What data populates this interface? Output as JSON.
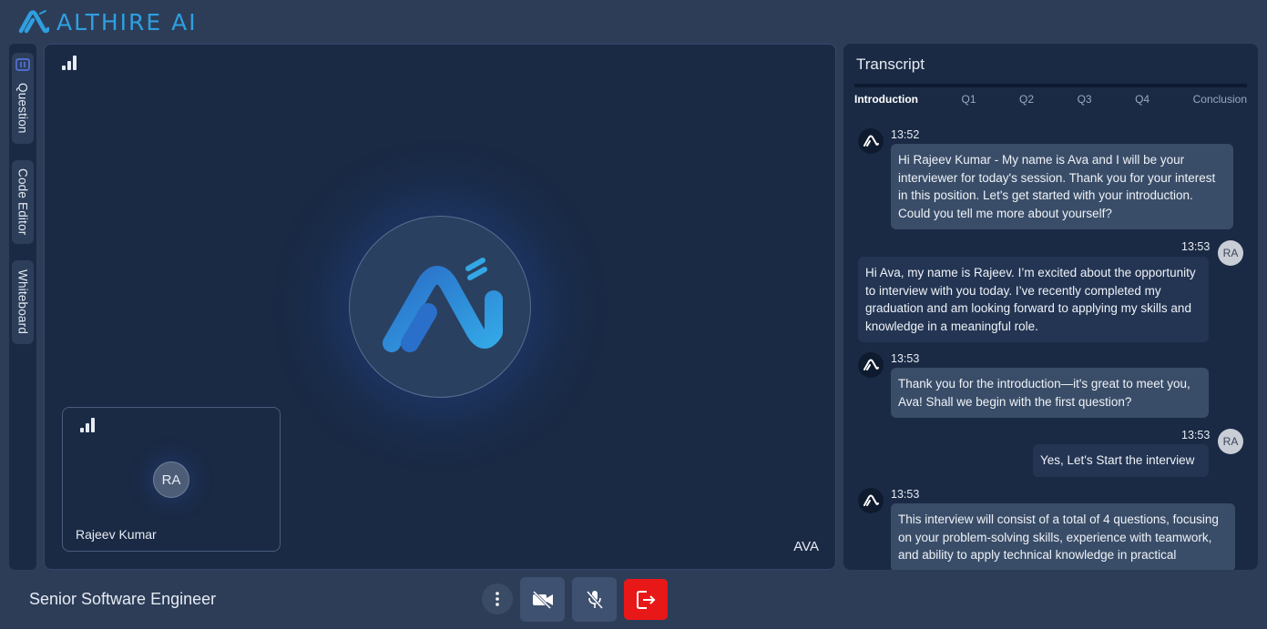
{
  "brand": {
    "name": "ALTHIRE AI",
    "color": "#2e9fe0",
    "logo_icon": "althire-logo-icon"
  },
  "sidebar": {
    "tabs": [
      {
        "label": "Question",
        "icon": "question-panel-icon",
        "active": true
      },
      {
        "label": "Code Editor"
      },
      {
        "label": "Whiteboard"
      }
    ]
  },
  "video": {
    "ai_label": "AVA",
    "self": {
      "initials": "RA",
      "name": "Rajeev Kumar"
    }
  },
  "transcript": {
    "title": "Transcript",
    "sections": [
      "Introduction",
      "Q1",
      "Q2",
      "Q3",
      "Q4",
      "Conclusion"
    ],
    "active_section": "Introduction",
    "messages": [
      {
        "from": "bot",
        "time": "13:52",
        "text": "Hi Rajeev Kumar - My name is Ava and I will be your interviewer for today's session. Thank you for your interest in this position. Let's get started with your introduction. Could you tell me more about yourself?"
      },
      {
        "from": "user",
        "initials": "RA",
        "time": "13:53",
        "text": "Hi Ava, my name is Rajeev. I’m excited about the opportunity to interview with you today. I’ve recently completed my graduation and am looking forward to applying my skills and knowledge in a meaningful role."
      },
      {
        "from": "bot",
        "time": "13:53",
        "text": "Thank you for the introduction—it's great to meet you, Ava! Shall we begin with the first question?"
      },
      {
        "from": "user",
        "initials": "RA",
        "time": "13:53",
        "text": "Yes, Let's Start the interview"
      },
      {
        "from": "bot",
        "time": "13:53",
        "text": "This interview will consist of a total of 4 questions, focusing on your problem-solving skills, experience with teamwork, and ability to apply technical knowledge in practical"
      }
    ]
  },
  "footer": {
    "role": "Senior Software Engineer",
    "controls": {
      "more": "more-options-icon",
      "camera": "camera-off-icon",
      "mic": "mic-off-icon",
      "leave": "leave-call-icon",
      "leave_color": "#e91818"
    }
  }
}
